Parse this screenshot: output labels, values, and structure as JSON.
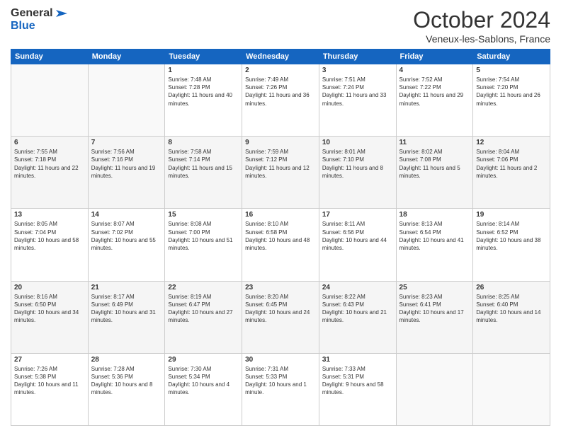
{
  "logo": {
    "line1": "General",
    "line2": "Blue"
  },
  "header": {
    "month": "October 2024",
    "location": "Veneux-les-Sablons, France"
  },
  "weekdays": [
    "Sunday",
    "Monday",
    "Tuesday",
    "Wednesday",
    "Thursday",
    "Friday",
    "Saturday"
  ],
  "weeks": [
    [
      {
        "day": "",
        "sunrise": "",
        "sunset": "",
        "daylight": ""
      },
      {
        "day": "",
        "sunrise": "",
        "sunset": "",
        "daylight": ""
      },
      {
        "day": "1",
        "sunrise": "Sunrise: 7:48 AM",
        "sunset": "Sunset: 7:28 PM",
        "daylight": "Daylight: 11 hours and 40 minutes."
      },
      {
        "day": "2",
        "sunrise": "Sunrise: 7:49 AM",
        "sunset": "Sunset: 7:26 PM",
        "daylight": "Daylight: 11 hours and 36 minutes."
      },
      {
        "day": "3",
        "sunrise": "Sunrise: 7:51 AM",
        "sunset": "Sunset: 7:24 PM",
        "daylight": "Daylight: 11 hours and 33 minutes."
      },
      {
        "day": "4",
        "sunrise": "Sunrise: 7:52 AM",
        "sunset": "Sunset: 7:22 PM",
        "daylight": "Daylight: 11 hours and 29 minutes."
      },
      {
        "day": "5",
        "sunrise": "Sunrise: 7:54 AM",
        "sunset": "Sunset: 7:20 PM",
        "daylight": "Daylight: 11 hours and 26 minutes."
      }
    ],
    [
      {
        "day": "6",
        "sunrise": "Sunrise: 7:55 AM",
        "sunset": "Sunset: 7:18 PM",
        "daylight": "Daylight: 11 hours and 22 minutes."
      },
      {
        "day": "7",
        "sunrise": "Sunrise: 7:56 AM",
        "sunset": "Sunset: 7:16 PM",
        "daylight": "Daylight: 11 hours and 19 minutes."
      },
      {
        "day": "8",
        "sunrise": "Sunrise: 7:58 AM",
        "sunset": "Sunset: 7:14 PM",
        "daylight": "Daylight: 11 hours and 15 minutes."
      },
      {
        "day": "9",
        "sunrise": "Sunrise: 7:59 AM",
        "sunset": "Sunset: 7:12 PM",
        "daylight": "Daylight: 11 hours and 12 minutes."
      },
      {
        "day": "10",
        "sunrise": "Sunrise: 8:01 AM",
        "sunset": "Sunset: 7:10 PM",
        "daylight": "Daylight: 11 hours and 8 minutes."
      },
      {
        "day": "11",
        "sunrise": "Sunrise: 8:02 AM",
        "sunset": "Sunset: 7:08 PM",
        "daylight": "Daylight: 11 hours and 5 minutes."
      },
      {
        "day": "12",
        "sunrise": "Sunrise: 8:04 AM",
        "sunset": "Sunset: 7:06 PM",
        "daylight": "Daylight: 11 hours and 2 minutes."
      }
    ],
    [
      {
        "day": "13",
        "sunrise": "Sunrise: 8:05 AM",
        "sunset": "Sunset: 7:04 PM",
        "daylight": "Daylight: 10 hours and 58 minutes."
      },
      {
        "day": "14",
        "sunrise": "Sunrise: 8:07 AM",
        "sunset": "Sunset: 7:02 PM",
        "daylight": "Daylight: 10 hours and 55 minutes."
      },
      {
        "day": "15",
        "sunrise": "Sunrise: 8:08 AM",
        "sunset": "Sunset: 7:00 PM",
        "daylight": "Daylight: 10 hours and 51 minutes."
      },
      {
        "day": "16",
        "sunrise": "Sunrise: 8:10 AM",
        "sunset": "Sunset: 6:58 PM",
        "daylight": "Daylight: 10 hours and 48 minutes."
      },
      {
        "day": "17",
        "sunrise": "Sunrise: 8:11 AM",
        "sunset": "Sunset: 6:56 PM",
        "daylight": "Daylight: 10 hours and 44 minutes."
      },
      {
        "day": "18",
        "sunrise": "Sunrise: 8:13 AM",
        "sunset": "Sunset: 6:54 PM",
        "daylight": "Daylight: 10 hours and 41 minutes."
      },
      {
        "day": "19",
        "sunrise": "Sunrise: 8:14 AM",
        "sunset": "Sunset: 6:52 PM",
        "daylight": "Daylight: 10 hours and 38 minutes."
      }
    ],
    [
      {
        "day": "20",
        "sunrise": "Sunrise: 8:16 AM",
        "sunset": "Sunset: 6:50 PM",
        "daylight": "Daylight: 10 hours and 34 minutes."
      },
      {
        "day": "21",
        "sunrise": "Sunrise: 8:17 AM",
        "sunset": "Sunset: 6:49 PM",
        "daylight": "Daylight: 10 hours and 31 minutes."
      },
      {
        "day": "22",
        "sunrise": "Sunrise: 8:19 AM",
        "sunset": "Sunset: 6:47 PM",
        "daylight": "Daylight: 10 hours and 27 minutes."
      },
      {
        "day": "23",
        "sunrise": "Sunrise: 8:20 AM",
        "sunset": "Sunset: 6:45 PM",
        "daylight": "Daylight: 10 hours and 24 minutes."
      },
      {
        "day": "24",
        "sunrise": "Sunrise: 8:22 AM",
        "sunset": "Sunset: 6:43 PM",
        "daylight": "Daylight: 10 hours and 21 minutes."
      },
      {
        "day": "25",
        "sunrise": "Sunrise: 8:23 AM",
        "sunset": "Sunset: 6:41 PM",
        "daylight": "Daylight: 10 hours and 17 minutes."
      },
      {
        "day": "26",
        "sunrise": "Sunrise: 8:25 AM",
        "sunset": "Sunset: 6:40 PM",
        "daylight": "Daylight: 10 hours and 14 minutes."
      }
    ],
    [
      {
        "day": "27",
        "sunrise": "Sunrise: 7:26 AM",
        "sunset": "Sunset: 5:38 PM",
        "daylight": "Daylight: 10 hours and 11 minutes."
      },
      {
        "day": "28",
        "sunrise": "Sunrise: 7:28 AM",
        "sunset": "Sunset: 5:36 PM",
        "daylight": "Daylight: 10 hours and 8 minutes."
      },
      {
        "day": "29",
        "sunrise": "Sunrise: 7:30 AM",
        "sunset": "Sunset: 5:34 PM",
        "daylight": "Daylight: 10 hours and 4 minutes."
      },
      {
        "day": "30",
        "sunrise": "Sunrise: 7:31 AM",
        "sunset": "Sunset: 5:33 PM",
        "daylight": "Daylight: 10 hours and 1 minute."
      },
      {
        "day": "31",
        "sunrise": "Sunrise: 7:33 AM",
        "sunset": "Sunset: 5:31 PM",
        "daylight": "Daylight: 9 hours and 58 minutes."
      },
      {
        "day": "",
        "sunrise": "",
        "sunset": "",
        "daylight": ""
      },
      {
        "day": "",
        "sunrise": "",
        "sunset": "",
        "daylight": ""
      }
    ]
  ]
}
